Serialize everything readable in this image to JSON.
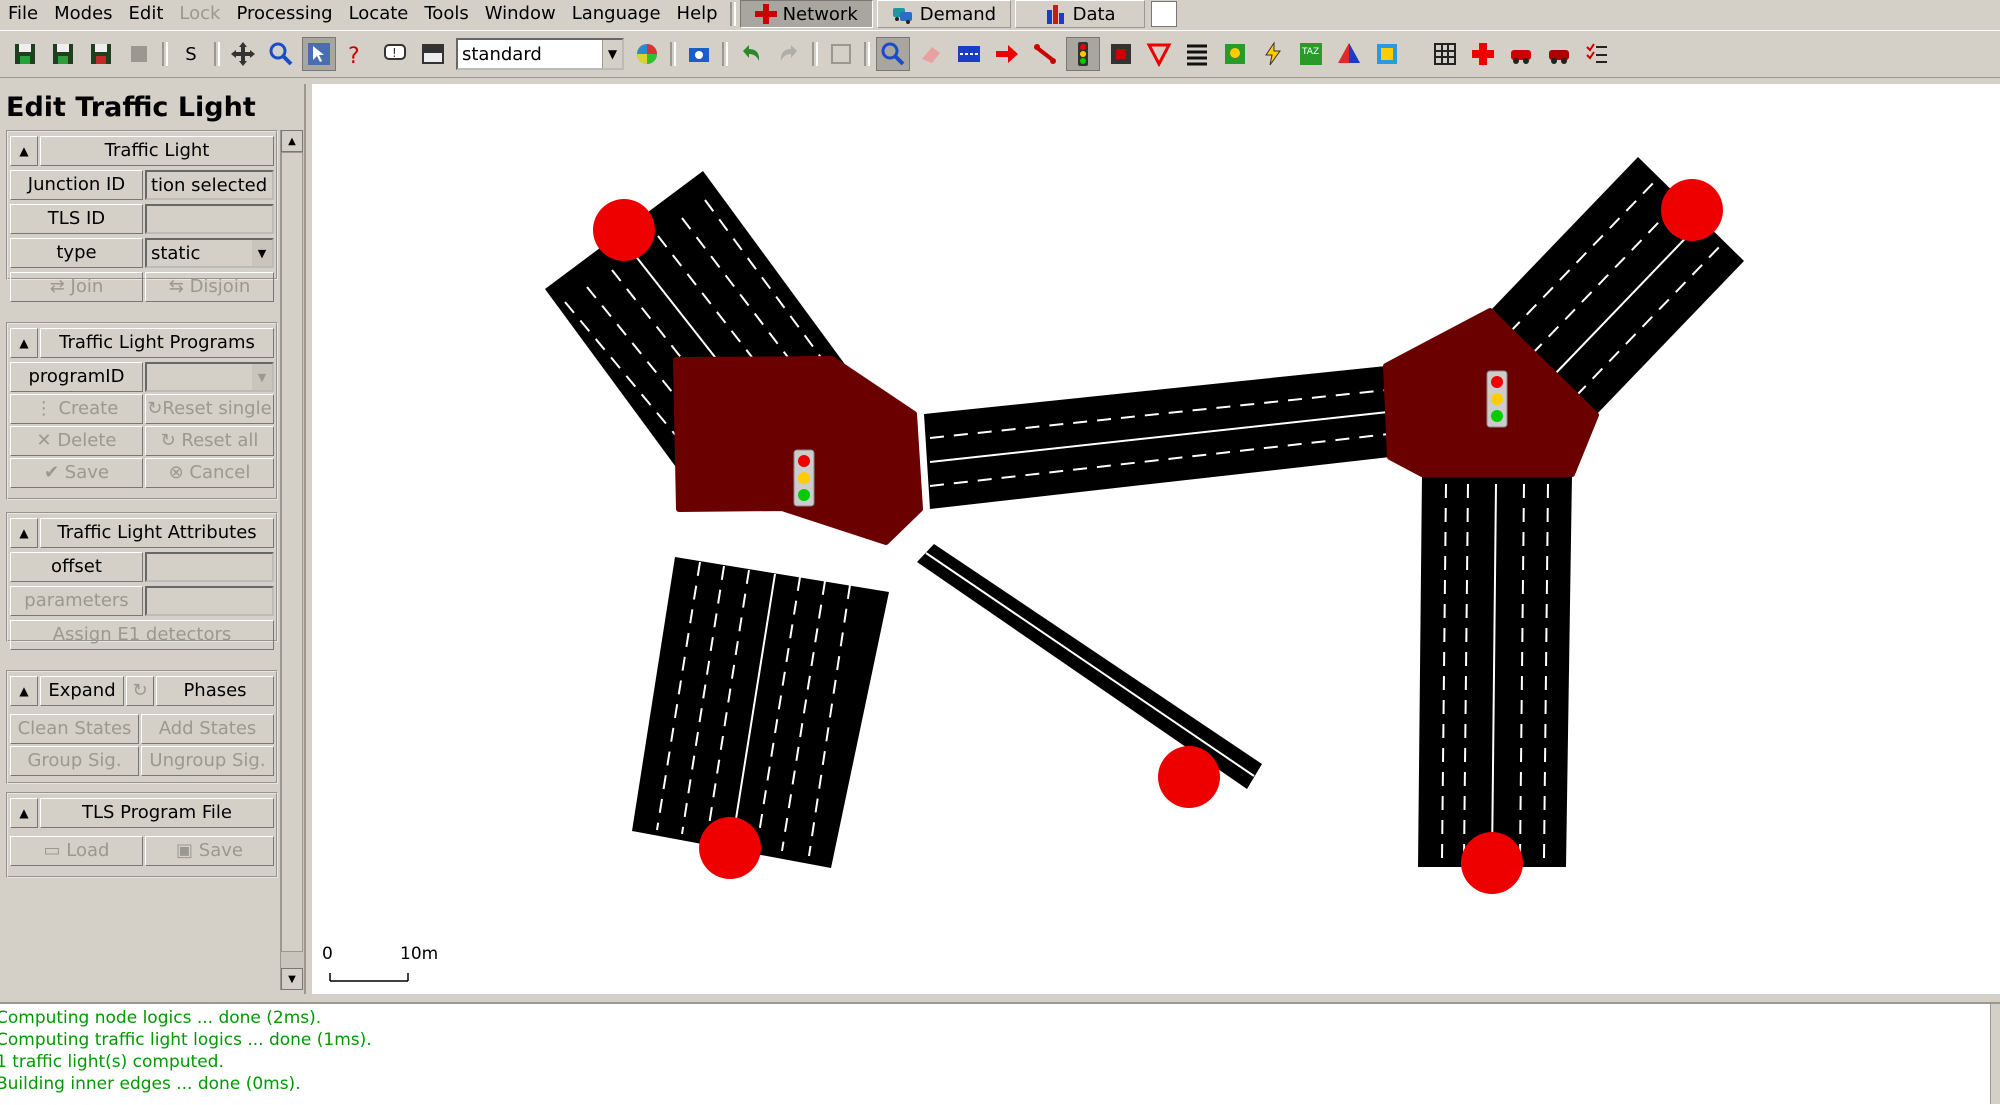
{
  "menubar": {
    "items": [
      {
        "label": "File",
        "enabled": true
      },
      {
        "label": "Modes",
        "enabled": true
      },
      {
        "label": "Edit",
        "enabled": true
      },
      {
        "label": "Lock",
        "enabled": false
      },
      {
        "label": "Processing",
        "enabled": true
      },
      {
        "label": "Locate",
        "enabled": true
      },
      {
        "label": "Tools",
        "enabled": true
      },
      {
        "label": "Window",
        "enabled": true
      },
      {
        "label": "Language",
        "enabled": true
      },
      {
        "label": "Help",
        "enabled": true
      }
    ],
    "supermodes": {
      "network": "Network",
      "demand": "Demand",
      "data": "Data",
      "active": "network"
    }
  },
  "toolbar": {
    "s_label": "S",
    "scheme_value": "standard"
  },
  "panel": {
    "title": "Edit Traffic Light",
    "traffic_light": {
      "title": "Traffic Light",
      "junction_id_label": "Junction ID",
      "junction_id_value": "tion selected",
      "tls_id_label": "TLS ID",
      "tls_id_value": "",
      "type_label": "type",
      "type_value": "static",
      "join_label": "Join",
      "disjoin_label": "Disjoin"
    },
    "programs": {
      "title": "Traffic Light Programs",
      "program_id_label": "programID",
      "program_id_value": "",
      "create_label": "Create",
      "reset_single_label": "Reset single",
      "delete_label": "Delete",
      "reset_all_label": "Reset all",
      "save_label": "Save",
      "cancel_label": "Cancel"
    },
    "attributes": {
      "title": "Traffic Light Attributes",
      "offset_label": "offset",
      "offset_value": "",
      "parameters_label": "parameters",
      "parameters_value": "",
      "assign_e1_label": "Assign E1 detectors"
    },
    "phases": {
      "expand_label": "Expand",
      "title": "Phases",
      "clean_states_label": "Clean States",
      "add_states_label": "Add States",
      "group_sig_label": "Group Sig.",
      "ungroup_sig_label": "Ungroup Sig."
    },
    "program_file": {
      "title": "TLS Program File",
      "load_label": "Load",
      "save_label": "Save"
    }
  },
  "canvas": {
    "scale_start": "0",
    "scale_end": "10m",
    "colors": {
      "road": "#000000",
      "junction": "#6b0000",
      "endpoint": "#e00000"
    }
  },
  "messages": [
    "Computing node logics ... done (2ms).",
    "Computing traffic light logics ... done (1ms).",
    "1 traffic light(s) computed.",
    "Building inner edges ... done (0ms)."
  ]
}
